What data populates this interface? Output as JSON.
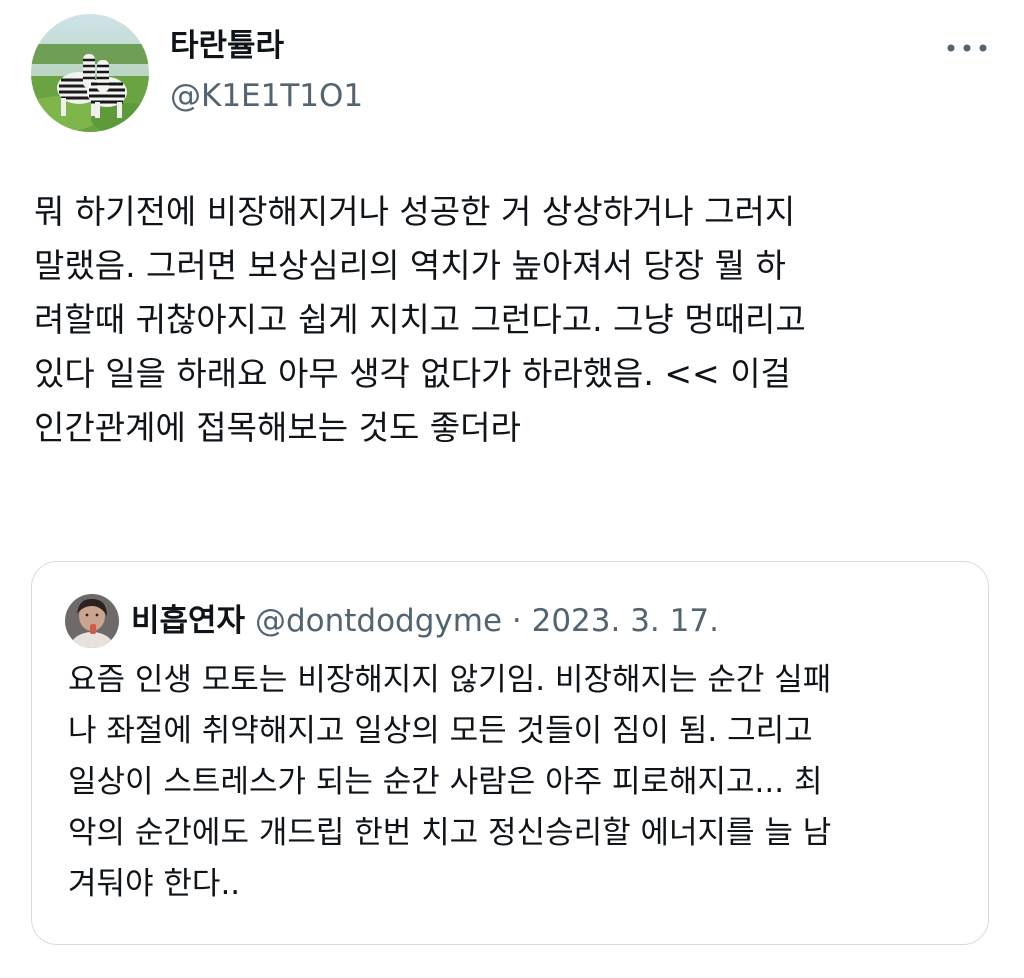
{
  "author": {
    "display_name": "타란튤라",
    "handle": "@K1E1T1O1",
    "avatar_icon": "zebra-photo-avatar"
  },
  "tweet": {
    "text": "뭐 하기전에 비장해지거나 성공한 거 상상하거나 그러지\n말랬음. 그러면 보상심리의 역치가 높아져서 당장 뭘 하\n려할때 귀찮아지고 쉽게 지치고 그런다고. 그냥 멍때리고\n있다 일을 하래요 아무 생각 없다가 하라했음. << 이걸\n인간관계에 접목해보는 것도 좋더라"
  },
  "menu": {
    "more_icon": "more-horizontal-icon"
  },
  "quoted_tweet": {
    "display_name": "비흡연자",
    "handle": "@dontdodgyme",
    "separator": "·",
    "date": "2023. 3. 17.",
    "text": "요즘 인생 모토는 비장해지지 않기임. 비장해지는 순간 실패\n나 좌절에 취약해지고 일상의 모든 것들이 짐이 됨. 그리고\n일상이 스트레스가 되는 순간 사람은 아주 피로해지고... 최\n악의 순간에도 개드립 한번 치고 정신승리할 에너지를 늘 남\n겨둬야 한다..",
    "avatar_icon": "person-photo-avatar"
  },
  "colors": {
    "text_primary": "#0f1419",
    "text_secondary": "#536471",
    "border": "#d6dde2"
  }
}
